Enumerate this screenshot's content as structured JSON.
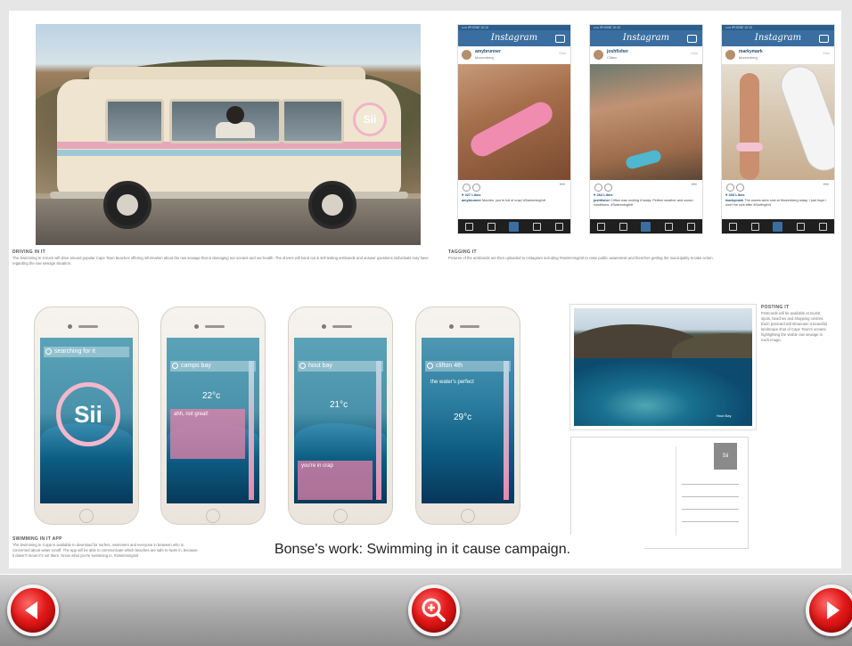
{
  "caption": "Bonse's work: Swimming in it cause campaign.",
  "panels": {
    "driving": {
      "title": "DRIVING IN IT",
      "text": "The Swimming In It truck will drive around popular Cape Town beaches offering information about the raw sewage that is damaging our oceans and our health. The drivers will hand out & sell testing armbands and answer questions individuals may have regarding the raw sewage situation."
    },
    "tagging": {
      "title": "TAGGING IT",
      "text": "Pictures of the armbands are then uploaded to Instagram including #SwimmingInIt to raise public awareness and therefore getting the municipality to take action."
    },
    "posting": {
      "title": "POSTING IT",
      "text": "Postcards will be available at tourist spots, beaches and shopping centres. Each postcard will showcase a beautiful landscape shot of Cape Town's oceans, highlighting the visible raw sewage in each image."
    },
    "swimming": {
      "title": "SWIMMING IN IT APP",
      "text": "The Swimming In It app is available to download for surfers, swimmers and everyone in between who is concerned about water runoff. The app will be able to communicate which beaches are safe to swim in, because it doesn't mean it's not there. Know what you're swimming in. #SwimmingInIt"
    }
  },
  "instagram": {
    "app_title": "Instagram",
    "posts": [
      {
        "user": "amybrunner",
        "location": "Muizenberg",
        "time": "24m",
        "likes": "♥ 427 Likes",
        "caption_user": "amybrunner",
        "caption": "Muizies, you're full of crap! #SwimmingInIt"
      },
      {
        "user": "joshfisher",
        "location": "Clifton",
        "time": "24m",
        "likes": "♥ 264 Likes",
        "caption_user": "joshfisher",
        "caption": "Clifton was rocking it today. Perfect weather and ocean conditions. #SwimmingInIt"
      },
      {
        "user": "markymark",
        "location": "Muizenberg",
        "time": "24m",
        "likes": "♥ 303 Likes",
        "caption_user": "markymark",
        "caption": "The waves were sick at Muizenberg today. I just hope I won't be sick after #SurfingInIt"
      }
    ]
  },
  "app_screens": [
    {
      "search": "searching for it"
    },
    {
      "search": "camps bay",
      "temp_top": "22°c",
      "headline": "ahh, not great!",
      "temp_bottom": ""
    },
    {
      "search": "hout bay",
      "temp_top": "21°c",
      "headline": "you're in crap",
      "temp_bottom": ""
    },
    {
      "search": "clifton 4th",
      "temp_top": "",
      "headline": "the water's perfect",
      "temp_bottom": "29°c"
    }
  ],
  "app_brand": "Sii",
  "landscape_label": "Hout Bay",
  "bottom_bar": {
    "prev_label": "previous",
    "zoom_label": "zoom",
    "next_label": "next"
  },
  "colors": {
    "nav_button": "#e01818",
    "instagram_header": "#3a6ea0",
    "accent_pink": "#f3b7cb"
  }
}
